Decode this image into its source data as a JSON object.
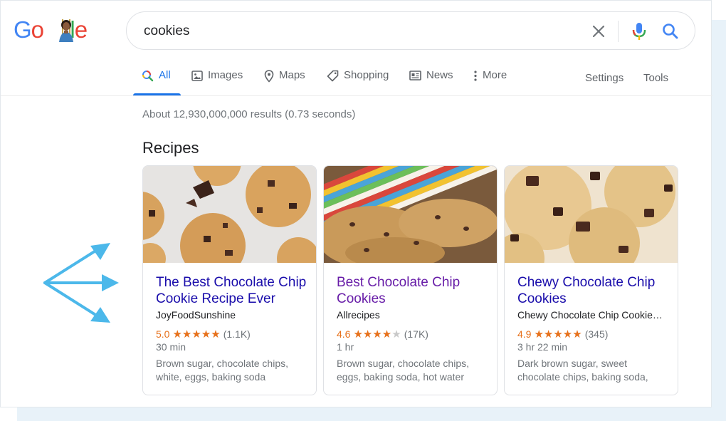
{
  "logo": {
    "letters": [
      "G",
      "o",
      "o",
      "l",
      "e"
    ],
    "colors": [
      "#4285f4",
      "#ea4335",
      "#fbbc05",
      "#34a853",
      "#ea4335"
    ]
  },
  "search": {
    "query": "cookies"
  },
  "icons": {
    "clear": "close-icon",
    "mic": "microphone-icon",
    "search": "search-icon"
  },
  "tabs": [
    {
      "label": "All",
      "icon": "search-icon",
      "active": true
    },
    {
      "label": "Images",
      "icon": "image-icon"
    },
    {
      "label": "Maps",
      "icon": "map-pin-icon"
    },
    {
      "label": "Shopping",
      "icon": "tag-icon"
    },
    {
      "label": "News",
      "icon": "newspaper-icon"
    },
    {
      "label": "More",
      "icon": "more-vertical-icon"
    }
  ],
  "tools": {
    "settings": "Settings",
    "tools": "Tools"
  },
  "results": {
    "stats": "About 12,930,000,000 results (0.73 seconds)"
  },
  "section": {
    "title": "Recipes"
  },
  "cards": [
    {
      "title_line1": "The Best Chocolate Chip",
      "title_line2": "Cookie Recipe Ever",
      "source": "JoyFoodSunshine",
      "rating": "5.0",
      "stars": 5,
      "reviews": "(1.1K)",
      "time": "30 min",
      "ingredients": "Brown sugar, chocolate chips, white, eggs, baking soda"
    },
    {
      "title_line1": "Best Chocolate Chip",
      "title_line2": "Cookies",
      "source": "Allrecipes",
      "rating": "4.6",
      "stars": 4.5,
      "reviews": "(17K)",
      "time": "1 hr",
      "ingredients": "Brown sugar, chocolate chips, eggs, baking soda, hot water"
    },
    {
      "title_line1": "Chewy Chocolate Chip",
      "title_line2": "Cookies",
      "source": "Chewy Chocolate Chip Cookie…",
      "rating": "4.9",
      "stars": 5,
      "reviews": "(345)",
      "time": "3 hr 22 min",
      "ingredients": "Dark brown sugar, sweet chocolate chips, baking soda,"
    }
  ],
  "colors": {
    "link": "#1a0dab",
    "visited": "#681da8",
    "accent": "#1a73e8",
    "star": "#e7711b",
    "arrow": "#4cb8ea"
  }
}
